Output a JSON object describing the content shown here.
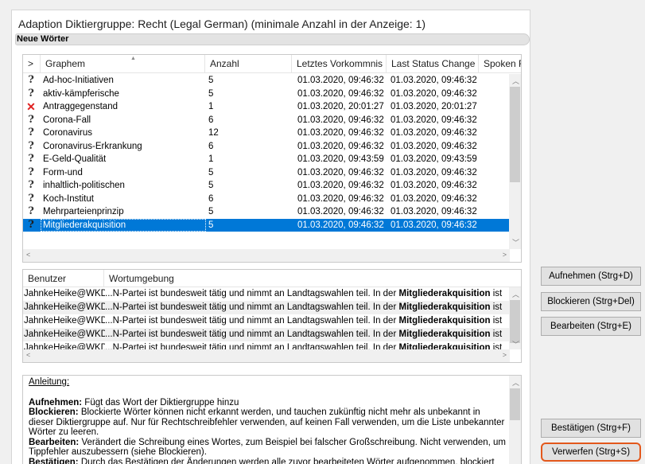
{
  "window": {
    "title": "Adaption Diktiergruppe: Recht (Legal German) (minimale Anzahl in der Anzeige: 1)",
    "section_label": "Neue Wörter"
  },
  "words_grid": {
    "columns": [
      ">",
      "Graphem",
      "Anzahl",
      "Letztes Vorkommnis",
      "Last Status Change",
      "Spoken F"
    ],
    "rows": [
      {
        "status_icon": "question-icon",
        "icon_glyph": "?",
        "graphem": "Ad-hoc-Initiativen",
        "anzahl": "5",
        "letztes": "01.03.2020, 09:46:32",
        "status_change": "01.03.2020, 09:46:32"
      },
      {
        "status_icon": "question-icon",
        "icon_glyph": "?",
        "graphem": "aktiv-kämpferische",
        "anzahl": "5",
        "letztes": "01.03.2020, 09:46:32",
        "status_change": "01.03.2020, 09:46:32"
      },
      {
        "status_icon": "blocked-x-icon",
        "icon_glyph": "✕",
        "graphem": "Antraggegenstand",
        "anzahl": "1",
        "letztes": "01.03.2020, 20:01:27",
        "status_change": "01.03.2020, 20:01:27"
      },
      {
        "status_icon": "question-icon",
        "icon_glyph": "?",
        "graphem": "Corona-Fall",
        "anzahl": "6",
        "letztes": "01.03.2020, 09:46:32",
        "status_change": "01.03.2020, 09:46:32"
      },
      {
        "status_icon": "question-icon",
        "icon_glyph": "?",
        "graphem": "Coronavirus",
        "anzahl": "12",
        "letztes": "01.03.2020, 09:46:32",
        "status_change": "01.03.2020, 09:46:32"
      },
      {
        "status_icon": "question-icon",
        "icon_glyph": "?",
        "graphem": "Coronavirus-Erkrankung",
        "anzahl": "6",
        "letztes": "01.03.2020, 09:46:32",
        "status_change": "01.03.2020, 09:46:32"
      },
      {
        "status_icon": "question-icon",
        "icon_glyph": "?",
        "graphem": "E-Geld-Qualität",
        "anzahl": "1",
        "letztes": "01.03.2020, 09:43:59",
        "status_change": "01.03.2020, 09:43:59"
      },
      {
        "status_icon": "question-icon",
        "icon_glyph": "?",
        "graphem": "Form-und",
        "anzahl": "5",
        "letztes": "01.03.2020, 09:46:32",
        "status_change": "01.03.2020, 09:46:32"
      },
      {
        "status_icon": "question-icon",
        "icon_glyph": "?",
        "graphem": "inhaltlich-politischen",
        "anzahl": "5",
        "letztes": "01.03.2020, 09:46:32",
        "status_change": "01.03.2020, 09:46:32"
      },
      {
        "status_icon": "question-icon",
        "icon_glyph": "?",
        "graphem": "Koch-Institut",
        "anzahl": "6",
        "letztes": "01.03.2020, 09:46:32",
        "status_change": "01.03.2020, 09:46:32"
      },
      {
        "status_icon": "question-icon",
        "icon_glyph": "?",
        "graphem": "Mehrparteienprinzip",
        "anzahl": "5",
        "letztes": "01.03.2020, 09:46:32",
        "status_change": "01.03.2020, 09:46:32"
      },
      {
        "status_icon": "question-icon",
        "icon_glyph": "?",
        "graphem": "Mitgliederakquisition",
        "anzahl": "5",
        "letztes": "01.03.2020, 09:46:32",
        "status_change": "01.03.2020, 09:46:32",
        "selected": true
      }
    ]
  },
  "context_grid": {
    "columns": [
      "Benutzer",
      "Wortumgebung"
    ],
    "rows": [
      {
        "user": "JahnkeHeike@WKD",
        "pre": "...N-Partei ist bundesweit tätig und nimmt an Landtagswahlen teil. In der ",
        "word": "Mitgliederakquisition",
        "post": " ist"
      },
      {
        "user": "JahnkeHeike@WKD",
        "pre": "...N-Partei ist bundesweit tätig und nimmt an Landtagswahlen teil. In der ",
        "word": "Mitgliederakquisition",
        "post": " ist"
      },
      {
        "user": "JahnkeHeike@WKD",
        "pre": "...N-Partei ist bundesweit tätig und nimmt an Landtagswahlen teil. In der ",
        "word": "Mitgliederakquisition",
        "post": " ist"
      },
      {
        "user": "JahnkeHeike@WKD",
        "pre": "...N-Partei ist bundesweit tätig und nimmt an Landtagswahlen teil. In der ",
        "word": "Mitgliederakquisition",
        "post": " ist"
      },
      {
        "user": "JahnkeHeike@WKD",
        "pre": "...N-Partei ist bundesweit tätig und nimmt an Landtagswahlen teil. In der ",
        "word": "Mitgliederakquisition",
        "post": " ist"
      }
    ]
  },
  "instructions": {
    "heading": "Anleitung:",
    "items": [
      {
        "term": "Aufnehmen:",
        "text": " Fügt das Wort der Diktiergruppe hinzu"
      },
      {
        "term": "Blockieren:",
        "text": " Blockierte Wörter können nicht erkannt werden, und tauchen zukünftig nicht mehr als unbekannt in dieser Diktiergruppe auf. Nur für Rechtschreibfehler verwenden, auf keinen Fall verwenden, um die Liste unbekannter Wörter zu leeren."
      },
      {
        "term": "Bearbeiten:",
        "text": " Verändert die Schreibung eines Wortes, zum Beispiel bei falscher Großschreibung. Nicht verwenden, um Tippfehler auszubessern (siehe Blockieren)."
      },
      {
        "term": "Bestätigen:",
        "text": " Durch das Bestätigen der Änderungen werden alle zuvor bearbeiteten Wörter aufgenommen, blockiert"
      }
    ]
  },
  "buttons": {
    "aufnehmen": "Aufnehmen (Strg+D)",
    "blockieren": "Blockieren (Strg+Del)",
    "bearbeiten": "Bearbeiten (Strg+E)",
    "bestaetigen": "Bestätigen (Strg+F)",
    "verwerfen": "Verwerfen (Strg+S)"
  },
  "colors": {
    "selection": "#0078d7",
    "blocked_icon": "#e02020",
    "highlight_border": "#e3581c"
  }
}
